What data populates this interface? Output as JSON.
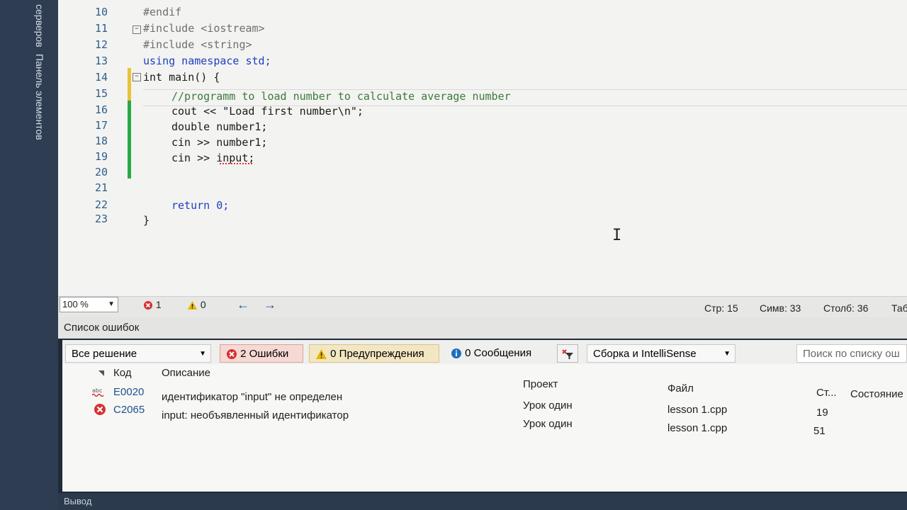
{
  "side_panel": {
    "tabs": [
      "Панель элементов",
      "серверов"
    ]
  },
  "editor": {
    "lines": [
      {
        "num": "10",
        "text": "#endif"
      },
      {
        "num": "11",
        "text": "#include <iostream>"
      },
      {
        "num": "12",
        "text": "#include <string>"
      },
      {
        "num": "13",
        "text": "using namespace std;"
      },
      {
        "num": "14",
        "text": "int main() {"
      },
      {
        "num": "15",
        "text": "//programm to load number to calculate average number"
      },
      {
        "num": "16",
        "text": "cout << \"Load first number\\n\";"
      },
      {
        "num": "17",
        "text": "double number1;"
      },
      {
        "num": "18",
        "text": "cin >> number1;"
      },
      {
        "num": "19",
        "text": "cin >> input;"
      },
      {
        "num": "20",
        "text": ""
      },
      {
        "num": "21",
        "text": ""
      },
      {
        "num": "22",
        "text": "return 0;"
      },
      {
        "num": "23",
        "text": "}"
      }
    ]
  },
  "statusbar": {
    "zoom": "100 %",
    "errors": "1",
    "warnings": "0",
    "line": "Стр: 15",
    "col": "Симв: 33",
    "column": "Столб: 36",
    "tab": "Таб"
  },
  "error_list": {
    "title": "Список ошибок",
    "scope": "Все решение",
    "errors_btn": "2 Ошибки",
    "warnings_btn": "0 Предупреждения",
    "messages_btn": "0 Сообщения",
    "build_filter": "Сборка и IntelliSense",
    "search_placeholder": "Поиск по списку ош",
    "columns": {
      "code": "Код",
      "description": "Описание",
      "project": "Проект",
      "file": "Файл",
      "line": "Ст...",
      "state": "Состояние"
    },
    "rows": [
      {
        "code": "E0020",
        "description": "идентификатор \"input\" не определен",
        "project": "Урок один",
        "file": "lesson 1.cpp",
        "line": "19"
      },
      {
        "code": "C2065",
        "description": "input: необъявленный идентификатор",
        "project": "Урок один",
        "file": "lesson 1.cpp",
        "line": "51"
      }
    ]
  },
  "output_tab": "Вывод",
  "colors": {
    "error_red": "#d83030",
    "warning_yellow": "#e8b400",
    "info_blue": "#1f6fc0",
    "change_green": "#2aa845",
    "change_yellow": "#e8c23a"
  }
}
